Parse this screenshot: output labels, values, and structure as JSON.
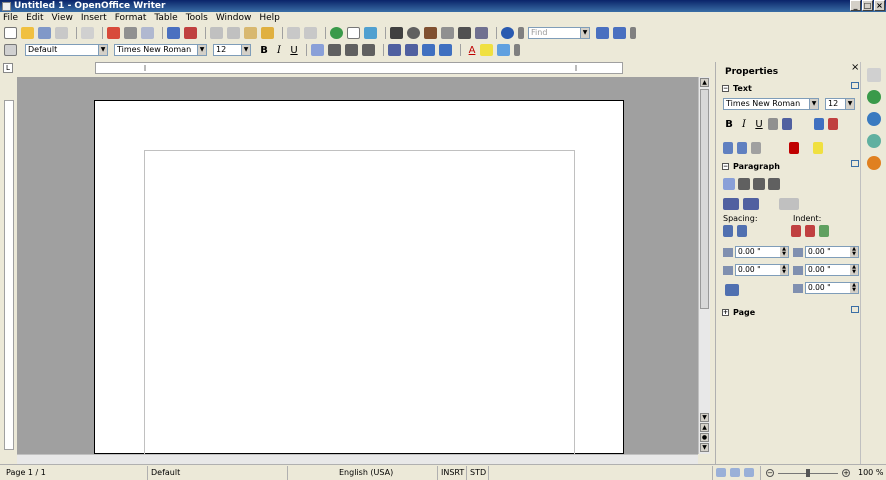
{
  "window": {
    "title": "Untitled 1 - OpenOffice Writer",
    "min": "_",
    "max": "□",
    "close": "×"
  },
  "menu": [
    "File",
    "Edit",
    "View",
    "Insert",
    "Format",
    "Table",
    "Tools",
    "Window",
    "Help"
  ],
  "find": {
    "placeholder": "Find",
    "value": "Find"
  },
  "format": {
    "style": "Default",
    "font": "Times New Roman",
    "size": "12",
    "bold": "B",
    "italic": "I",
    "underline": "U",
    "font_color": "A"
  },
  "ruler": {
    "corner": "L"
  },
  "sidebar": {
    "title": "Properties",
    "close": "×",
    "text_section": "Text",
    "font": "Times New Roman",
    "size": "12",
    "bold": "B",
    "italic": "I",
    "underline": "U",
    "paragraph_section": "Paragraph",
    "spacing_label": "Spacing:",
    "indent_label": "Indent:",
    "above": "0.00 \"",
    "below": "0.00 \"",
    "before_text": "0.00 \"",
    "after_text": "0.00 \"",
    "first_line": "0.00 \"",
    "page_section": "Page"
  },
  "status": {
    "page": "Page 1 / 1",
    "style": "Default",
    "language": "English (USA)",
    "insert": "INSRT",
    "selection": "STD",
    "zoom": "100 %"
  },
  "colors": {
    "titlebar": "#0a246a",
    "workspace": "#a0a0a0",
    "chrome": "#ece9d8"
  }
}
